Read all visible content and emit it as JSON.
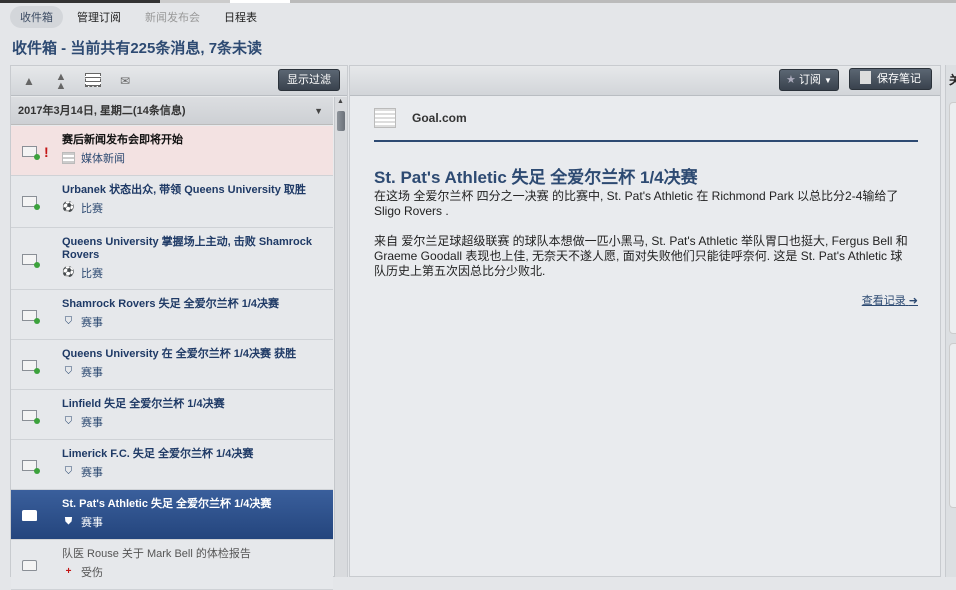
{
  "tabs": [
    {
      "label": "收件箱",
      "state": "active"
    },
    {
      "label": "管理订阅",
      "state": "normal"
    },
    {
      "label": "新闻发布会",
      "state": "disabled"
    },
    {
      "label": "日程表",
      "state": "normal"
    }
  ],
  "title": "收件箱 - 当前共有225条消息, 7条未读",
  "left_toolbar": {
    "icons": [
      "arrow-up-icon",
      "double-arrow-up-icon",
      "select-all-icon",
      "mail-icon"
    ],
    "filter_button": "显示过滤"
  },
  "date_header": "2017年3月14日, 星期二(14条信息)",
  "messages": [
    {
      "title": "赛后新闻发布会即将开始",
      "category": "媒体新闻",
      "icon": "newspaper-icon",
      "urgent": true
    },
    {
      "title": "Urbanek 状态出众, 带领 Queens University 取胜",
      "category": "比赛",
      "icon": "football-icon"
    },
    {
      "title": "Queens University 掌握场上主动, 击败 Shamrock Rovers",
      "category": "比赛",
      "icon": "football-icon"
    },
    {
      "title": "Shamrock Rovers 失足 全爱尔兰杯 1/4决赛",
      "category": "赛事",
      "icon": "shield-icon"
    },
    {
      "title": "Queens University 在 全爱尔兰杯 1/4决赛 获胜",
      "category": "赛事",
      "icon": "shield-icon"
    },
    {
      "title": "Linfield 失足 全爱尔兰杯 1/4决赛",
      "category": "赛事",
      "icon": "shield-icon"
    },
    {
      "title": "Limerick F.C. 失足 全爱尔兰杯 1/4决赛",
      "category": "赛事",
      "icon": "shield-icon"
    },
    {
      "title": "St. Pat's Athletic 失足 全爱尔兰杯 1/4决赛",
      "category": "赛事",
      "icon": "shield-icon",
      "selected": true
    },
    {
      "title": "队医 Rouse 关于 Mark Bell 的体检报告",
      "category": "受伤",
      "icon": "injury-cross-icon",
      "read": true
    }
  ],
  "main_toolbar": {
    "subscribe": "订阅",
    "save_note": "保存笔记"
  },
  "article": {
    "source": "Goal.com",
    "headline": "St. Pat's Athletic 失足 全爱尔兰杯 1/4决赛",
    "paragraphs": [
      "在这场 全爱尔兰杯 四分之一决赛 的比赛中, St. Pat's Athletic 在 Richmond Park 以总比分2-4输给了 Sligo Rovers .",
      "来自 爱尔兰足球超级联赛 的球队本想做一匹小黑马, St. Pat's Athletic 举队胃口也挺大, Fergus Bell 和 Graeme Goodall 表现也上佳, 无奈天不遂人愿, 面对失败他们只能徒呼奈何. 这是 St. Pat's Athletic 球队历史上第五次因总比分少败北."
    ],
    "view_history": "查看记录"
  },
  "right_panel": {
    "header": "关"
  }
}
